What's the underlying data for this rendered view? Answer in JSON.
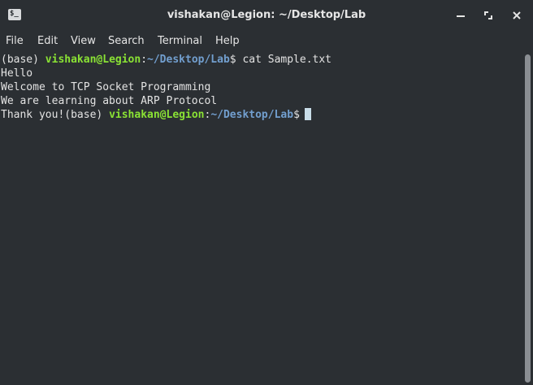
{
  "window": {
    "title": "vishakan@Legion: ~/Desktop/Lab",
    "app_icon_glyph": "$_",
    "buttons": {
      "minimize": "minimize-icon",
      "maximize": "maximize-icon",
      "close": "close-icon"
    }
  },
  "menu": {
    "items": [
      "File",
      "Edit",
      "View",
      "Search",
      "Terminal",
      "Help"
    ]
  },
  "terminal": {
    "line1": {
      "env": "(base) ",
      "user": "vishakan@Legion",
      "colon": ":",
      "path": "~/Desktop/Lab",
      "prompt": "$ ",
      "command": "cat Sample.txt"
    },
    "output": [
      "Hello",
      "Welcome to TCP Socket Programming",
      "We are learning about ARP Protocol"
    ],
    "line5": {
      "output_tail": "Thank you!",
      "env": "(base) ",
      "user": "vishakan@Legion",
      "colon": ":",
      "path": "~/Desktop/Lab",
      "prompt": "$"
    }
  },
  "colors": {
    "background": "#2b2f33",
    "text": "#e3e3e3",
    "user": "#8ae234",
    "path": "#729fcf",
    "cursor": "#c9dde8"
  }
}
